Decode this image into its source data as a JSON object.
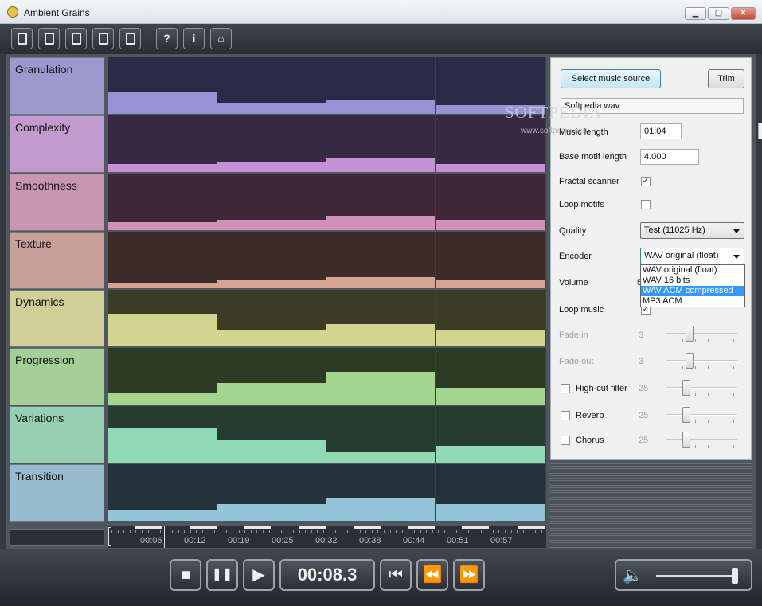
{
  "window": {
    "title": "Ambient Grains",
    "minimize": "▁",
    "maximize": "▢",
    "close": "✕"
  },
  "toolbar": {
    "help": "?",
    "info": "i",
    "home": "⌂"
  },
  "rows": [
    {
      "label": "Granulation",
      "bg": "#9a9acf",
      "dark": "#2b2b48",
      "fill": "#9593d4",
      "levels": [
        0.38,
        0.2,
        0.26,
        0.16
      ]
    },
    {
      "label": "Complexity",
      "bg": "#c19ace",
      "dark": "#392a44",
      "fill": "#c490d8",
      "levels": [
        0.14,
        0.18,
        0.25,
        0.14
      ]
    },
    {
      "label": "Smoothness",
      "bg": "#c896b0",
      "dark": "#3f2838",
      "fill": "#d190b8",
      "levels": [
        0.14,
        0.18,
        0.26,
        0.18
      ]
    },
    {
      "label": "Texture",
      "bg": "#c9a097",
      "dark": "#3d2c28",
      "fill": "#d6a294",
      "levels": [
        0.1,
        0.16,
        0.2,
        0.16
      ]
    },
    {
      "label": "Dynamics",
      "bg": "#cfcf97",
      "dark": "#3b3b26",
      "fill": "#d3d48f",
      "levels": [
        0.58,
        0.3,
        0.4,
        0.3
      ]
    },
    {
      "label": "Progression",
      "bg": "#a6cf97",
      "dark": "#2b3b26",
      "fill": "#a2d690",
      "levels": [
        0.2,
        0.38,
        0.58,
        0.3
      ]
    },
    {
      "label": "Variations",
      "bg": "#97cfb3",
      "dark": "#263b31",
      "fill": "#91d8b5",
      "levels": [
        0.6,
        0.4,
        0.18,
        0.3
      ]
    },
    {
      "label": "Transition",
      "bg": "#97bccf",
      "dark": "#26323b",
      "fill": "#93c4d8",
      "levels": [
        0.18,
        0.3,
        0.4,
        0.3
      ]
    }
  ],
  "timeline": {
    "ticks": [
      "00:06",
      "00:12",
      "00:19",
      "00:25",
      "00:32",
      "00:38",
      "00:44",
      "00:51",
      "00:57"
    ]
  },
  "panel": {
    "select_source": "Select music source",
    "trim": "Trim",
    "filename": "Softpedia.wav",
    "music_length_label": "Music length",
    "music_length": "01:04",
    "base_motif_label": "Base motif length",
    "base_motif": "4.000",
    "fractal_label": "Fractal scanner",
    "fractal_checked": "✓",
    "loop_motifs_label": "Loop motifs",
    "quality_label": "Quality",
    "quality_value": "Test   (11025 Hz)",
    "encoder_label": "Encoder",
    "encoder_value": "WAV original (float)",
    "encoder_options": [
      "WAV original (float)",
      "WAV 16 bits",
      "WAV ACM compressed",
      "MP3 ACM"
    ],
    "volume_label": "Volume",
    "volume_value": "5",
    "loop_music_label": "Loop music",
    "loop_music_checked": "✓",
    "fade_in_label": "Fade in",
    "fade_in_value": "3",
    "fade_out_label": "Fade out",
    "fade_out_value": "3",
    "highcut_label": "High-cut filter",
    "highcut_value": "25",
    "reverb_label": "Reverb",
    "reverb_value": "25",
    "chorus_label": "Chorus",
    "chorus_value": "25",
    "watermark": "SOFTPEDIA",
    "watermark_sub": "www.softpedia.com"
  },
  "transport": {
    "time": "00:08.3",
    "stop": "■",
    "pause": "❚❚",
    "play": "▶",
    "skip_back": "⏮",
    "rewind": "⏪",
    "forward": "⏩",
    "speaker": "🔈",
    "volume_level": 0.97
  }
}
